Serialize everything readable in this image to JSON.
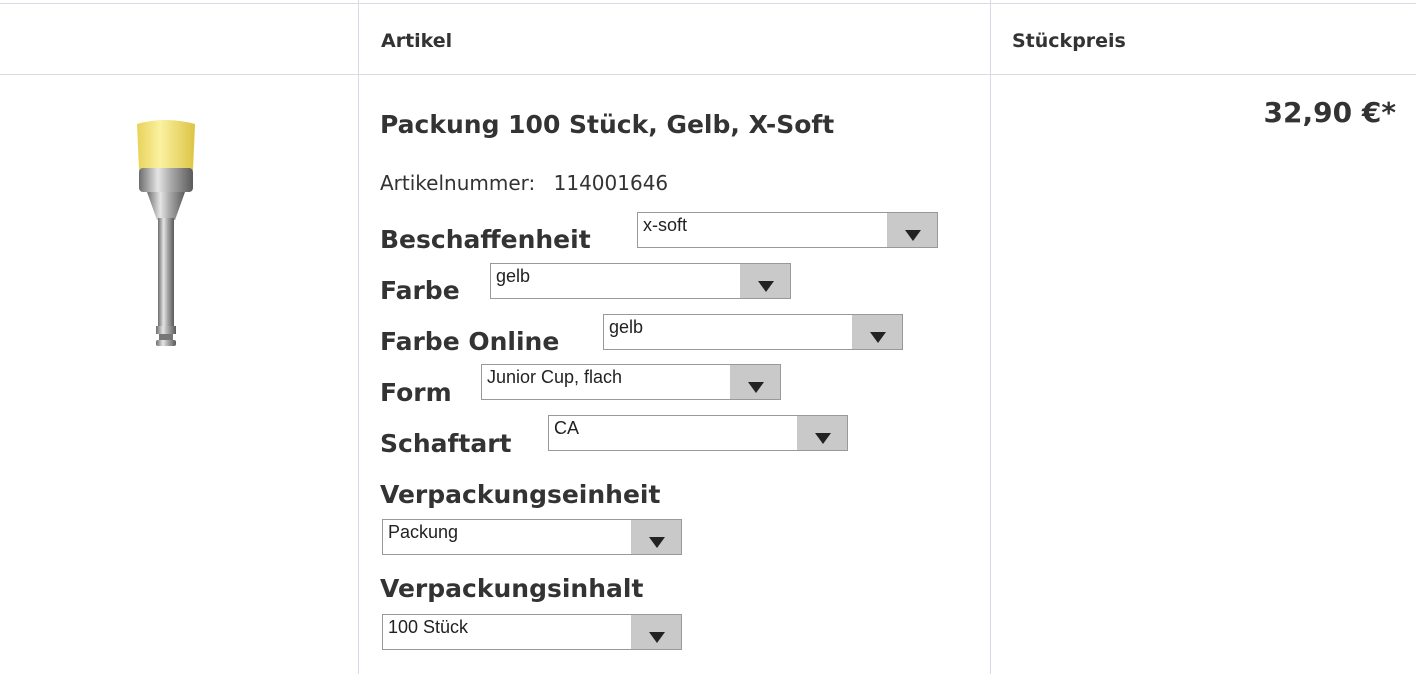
{
  "table": {
    "header": {
      "article_label": "Artikel",
      "price_label": "Stückpreis"
    }
  },
  "product": {
    "image_alt": "Polierbürstchen gelb",
    "title": "Packung 100 Stück, Gelb, X-Soft",
    "article_number_label": "Artikelnummer:",
    "article_number": "114001646",
    "price": "32,90 €*",
    "options": [
      {
        "label": "Beschaffenheit",
        "value": "x-soft"
      },
      {
        "label": "Farbe",
        "value": "gelb"
      },
      {
        "label": "Farbe Online",
        "value": "gelb"
      },
      {
        "label": "Form",
        "value": "Junior Cup, flach"
      },
      {
        "label": "Schaftart",
        "value": "CA"
      },
      {
        "label": "Verpackungseinheit",
        "value": "Packung"
      },
      {
        "label": "Verpackungsinhalt",
        "value": "100 Stück"
      }
    ]
  },
  "colors": {
    "border": "#dadae5",
    "text": "#333333",
    "select_arrow_bg": "#c9c9c9",
    "brush_yellow": "#f5e77a"
  }
}
